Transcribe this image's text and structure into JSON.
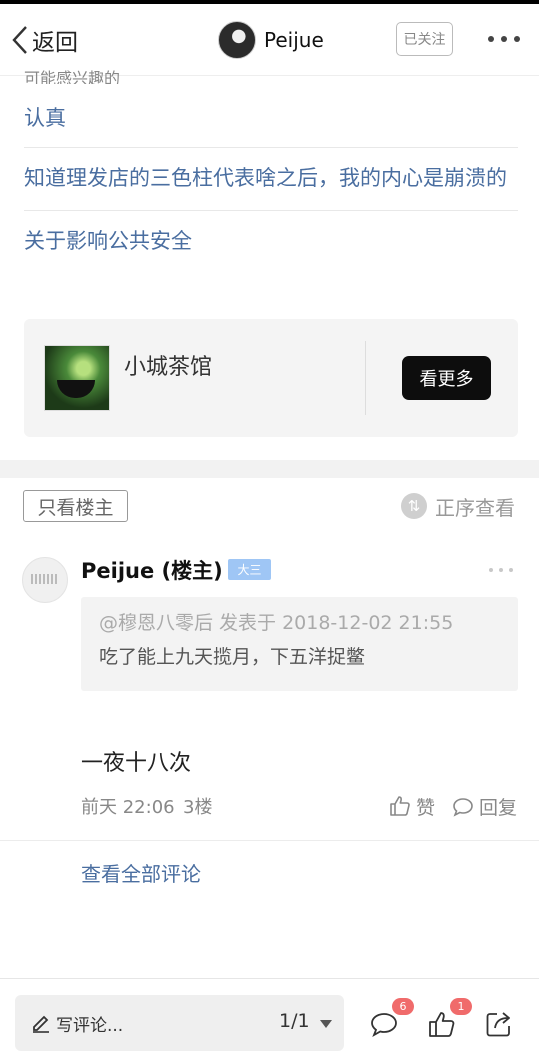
{
  "header": {
    "back_label": "返回",
    "username": "Peijue",
    "follow_label": "已关注"
  },
  "recommendations": {
    "section_label": "可能感兴趣的",
    "items": [
      {
        "title": "认真"
      },
      {
        "title": "知道理发店的三色柱代表啥之后，我的内心是崩溃的"
      },
      {
        "title": "关于影响公共安全"
      }
    ]
  },
  "forum_card": {
    "name": "小城茶馆",
    "button_label": "看更多"
  },
  "filters": {
    "owner_only_label": "只看楼主",
    "sort_label": "正序查看"
  },
  "reply": {
    "author": "Peijue (楼主)",
    "level": "大三",
    "quote_meta": "@穆恩八零后 发表于 2018-12-02 21:55",
    "quote_text": "吃了能上九天揽月，下五洋捉鳖",
    "body": "一夜十八次",
    "time": "前天 22:06",
    "floor": "3楼",
    "like_label": "赞",
    "reply_label": "回复"
  },
  "view_all_label": "查看全部评论",
  "bottom_bar": {
    "comment_placeholder": "写评论...",
    "page_indicator": "1/1",
    "comment_count": "6",
    "like_count": "1"
  },
  "colors": {
    "link": "#4a6ea0",
    "level_badge": "#9fc6f5",
    "notification_badge": "#f06b6b",
    "button_dark": "#0d0d0d"
  },
  "icons": [
    "back-chevron-icon",
    "more-icon",
    "sort-icon",
    "thumbs-up-icon",
    "comment-icon",
    "pencil-icon",
    "dropdown-icon",
    "share-icon"
  ]
}
